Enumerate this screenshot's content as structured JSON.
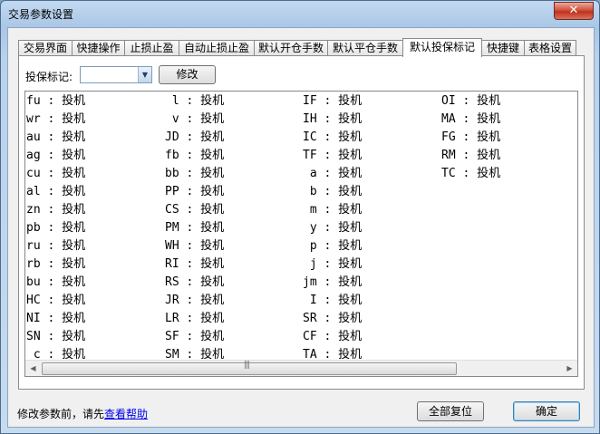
{
  "window": {
    "title": "交易参数设置",
    "close_glyph": "✕"
  },
  "tabs": [
    {
      "label": "交易界面"
    },
    {
      "label": "快捷操作"
    },
    {
      "label": "止损止盈"
    },
    {
      "label": "自动止损止盈"
    },
    {
      "label": "默认开仓手数"
    },
    {
      "label": "默认平仓手数"
    },
    {
      "label": "默认投保标记"
    },
    {
      "label": "快捷键"
    },
    {
      "label": "表格设置"
    }
  ],
  "active_tab": "默认投保标记",
  "panel": {
    "mark_label": "投保标记:",
    "combo_value": "",
    "modify_label": "修改"
  },
  "list": {
    "columns": [
      [
        "fu : 投机",
        "wr : 投机",
        "au : 投机",
        "ag : 投机",
        "cu : 投机",
        "al : 投机",
        "zn : 投机",
        "pb : 投机",
        "ru : 投机",
        "rb : 投机",
        "bu : 投机",
        "HC : 投机",
        "NI : 投机",
        "SN : 投机",
        " c : 投机"
      ],
      [
        " l : 投机",
        " v : 投机",
        "JD : 投机",
        "fb : 投机",
        "bb : 投机",
        "PP : 投机",
        "CS : 投机",
        "PM : 投机",
        "WH : 投机",
        "RI : 投机",
        "RS : 投机",
        "JR : 投机",
        "LR : 投机",
        "SF : 投机",
        "SM : 投机"
      ],
      [
        "IF : 投机",
        "IH : 投机",
        "IC : 投机",
        "TF : 投机",
        " a : 投机",
        " b : 投机",
        " m : 投机",
        " y : 投机",
        " p : 投机",
        " j : 投机",
        "jm : 投机",
        " I : 投机",
        "SR : 投机",
        "CF : 投机",
        "TA : 投机"
      ],
      [
        "OI : 投机",
        "MA : 投机",
        "FG : 投机",
        "RM : 投机",
        "TC : 投机"
      ]
    ]
  },
  "scrollbar": {
    "left_icon": "◀",
    "right_icon": "▶",
    "grip": "|||"
  },
  "footer": {
    "hint_prefix": "修改参数前，请先",
    "help_link": "查看帮助",
    "reset_label": "全部复位",
    "ok_label": "确定"
  }
}
